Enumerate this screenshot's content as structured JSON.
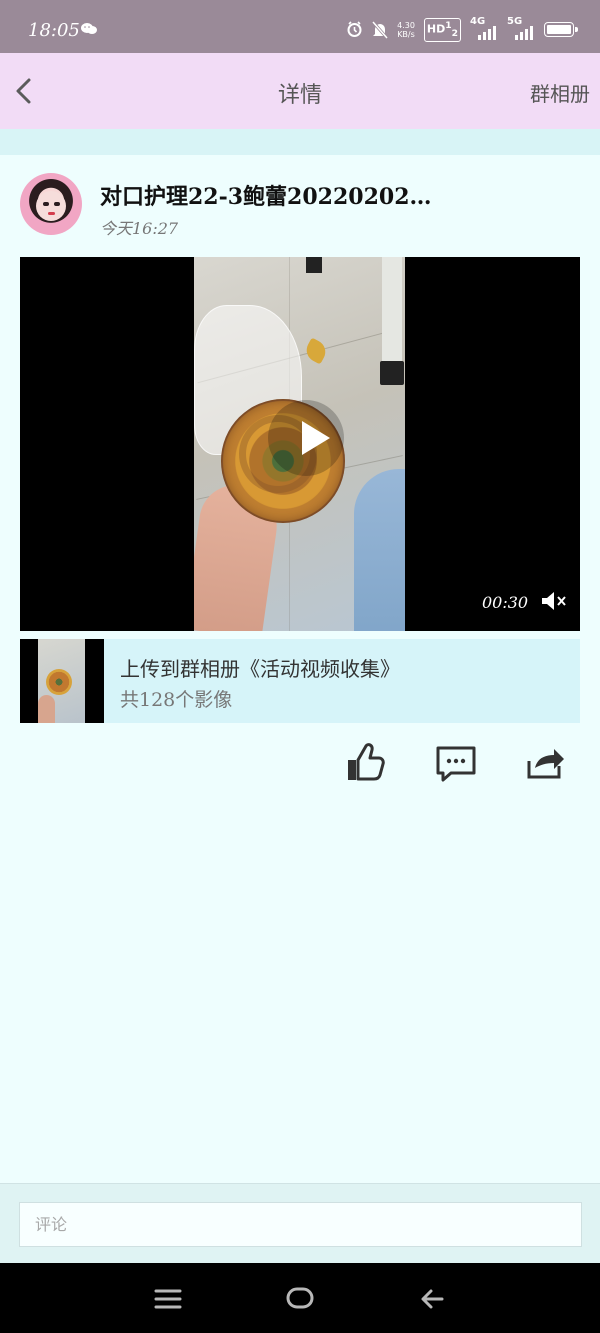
{
  "status_bar": {
    "time": "18:05",
    "network_speed_value": "4.30",
    "network_speed_unit": "KB/s",
    "hd_label": "HD",
    "hd_sub": "1",
    "hd_sub2": "2",
    "signal_4g_label": "4G",
    "signal_5g_label": "5G",
    "wechat_icon": "wechat-icon",
    "alarm_icon": "alarm-icon",
    "mute_bell_icon": "bell-off-icon"
  },
  "nav": {
    "title": "详情",
    "right_label": "群相册",
    "back_icon": "chevron-left-icon"
  },
  "post": {
    "title": "对口护理22-3鲍蕾20220202…",
    "time": "今天16:27"
  },
  "video": {
    "duration": "00:30",
    "play_icon": "play-icon",
    "mute_icon": "volume-muted-icon"
  },
  "album": {
    "title": "上传到群相册《活动视频收集》",
    "count": "共128个影像"
  },
  "actions": {
    "like_icon": "thumbs-up-icon",
    "comment_icon": "comment-icon",
    "share_icon": "share-icon"
  },
  "comment": {
    "placeholder": "评论"
  },
  "system_nav": {
    "menu_icon": "menu-icon",
    "home_icon": "home-icon",
    "back_icon": "back-arrow-icon"
  }
}
